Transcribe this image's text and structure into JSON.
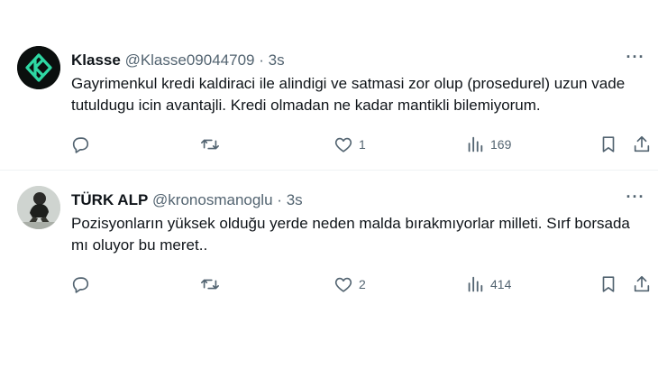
{
  "tweets": [
    {
      "name": "Klasse",
      "handle": "@Klasse09044709",
      "separator": "·",
      "time": "3s",
      "text": "Gayrimenkul kredi kaldiraci ile alindigi ve satmasi zor olup (prosedurel) uzun vade tutuldugu icin avantajli. Kredi olmadan ne kadar mantikli bilemiyorum.",
      "avatar": "klasse-logo",
      "replies": "",
      "reposts": "",
      "likes": "1",
      "views": "169",
      "more": "···"
    },
    {
      "name": "TÜRK ALP",
      "handle": "@kronosmanoglu",
      "separator": "·",
      "time": "3s",
      "text": "Pozisyonların yüksek olduğu yerde neden malda bırakmıyorlar milleti. Sırf borsada mı oluyor bu meret..",
      "avatar": "user-photo",
      "replies": "",
      "reposts": "",
      "likes": "2",
      "views": "414",
      "more": "···"
    }
  ],
  "colors": {
    "text": "#0f1419",
    "secondary": "#536471",
    "divider": "#eff3f4",
    "brand_green": "#2ed8a3"
  }
}
